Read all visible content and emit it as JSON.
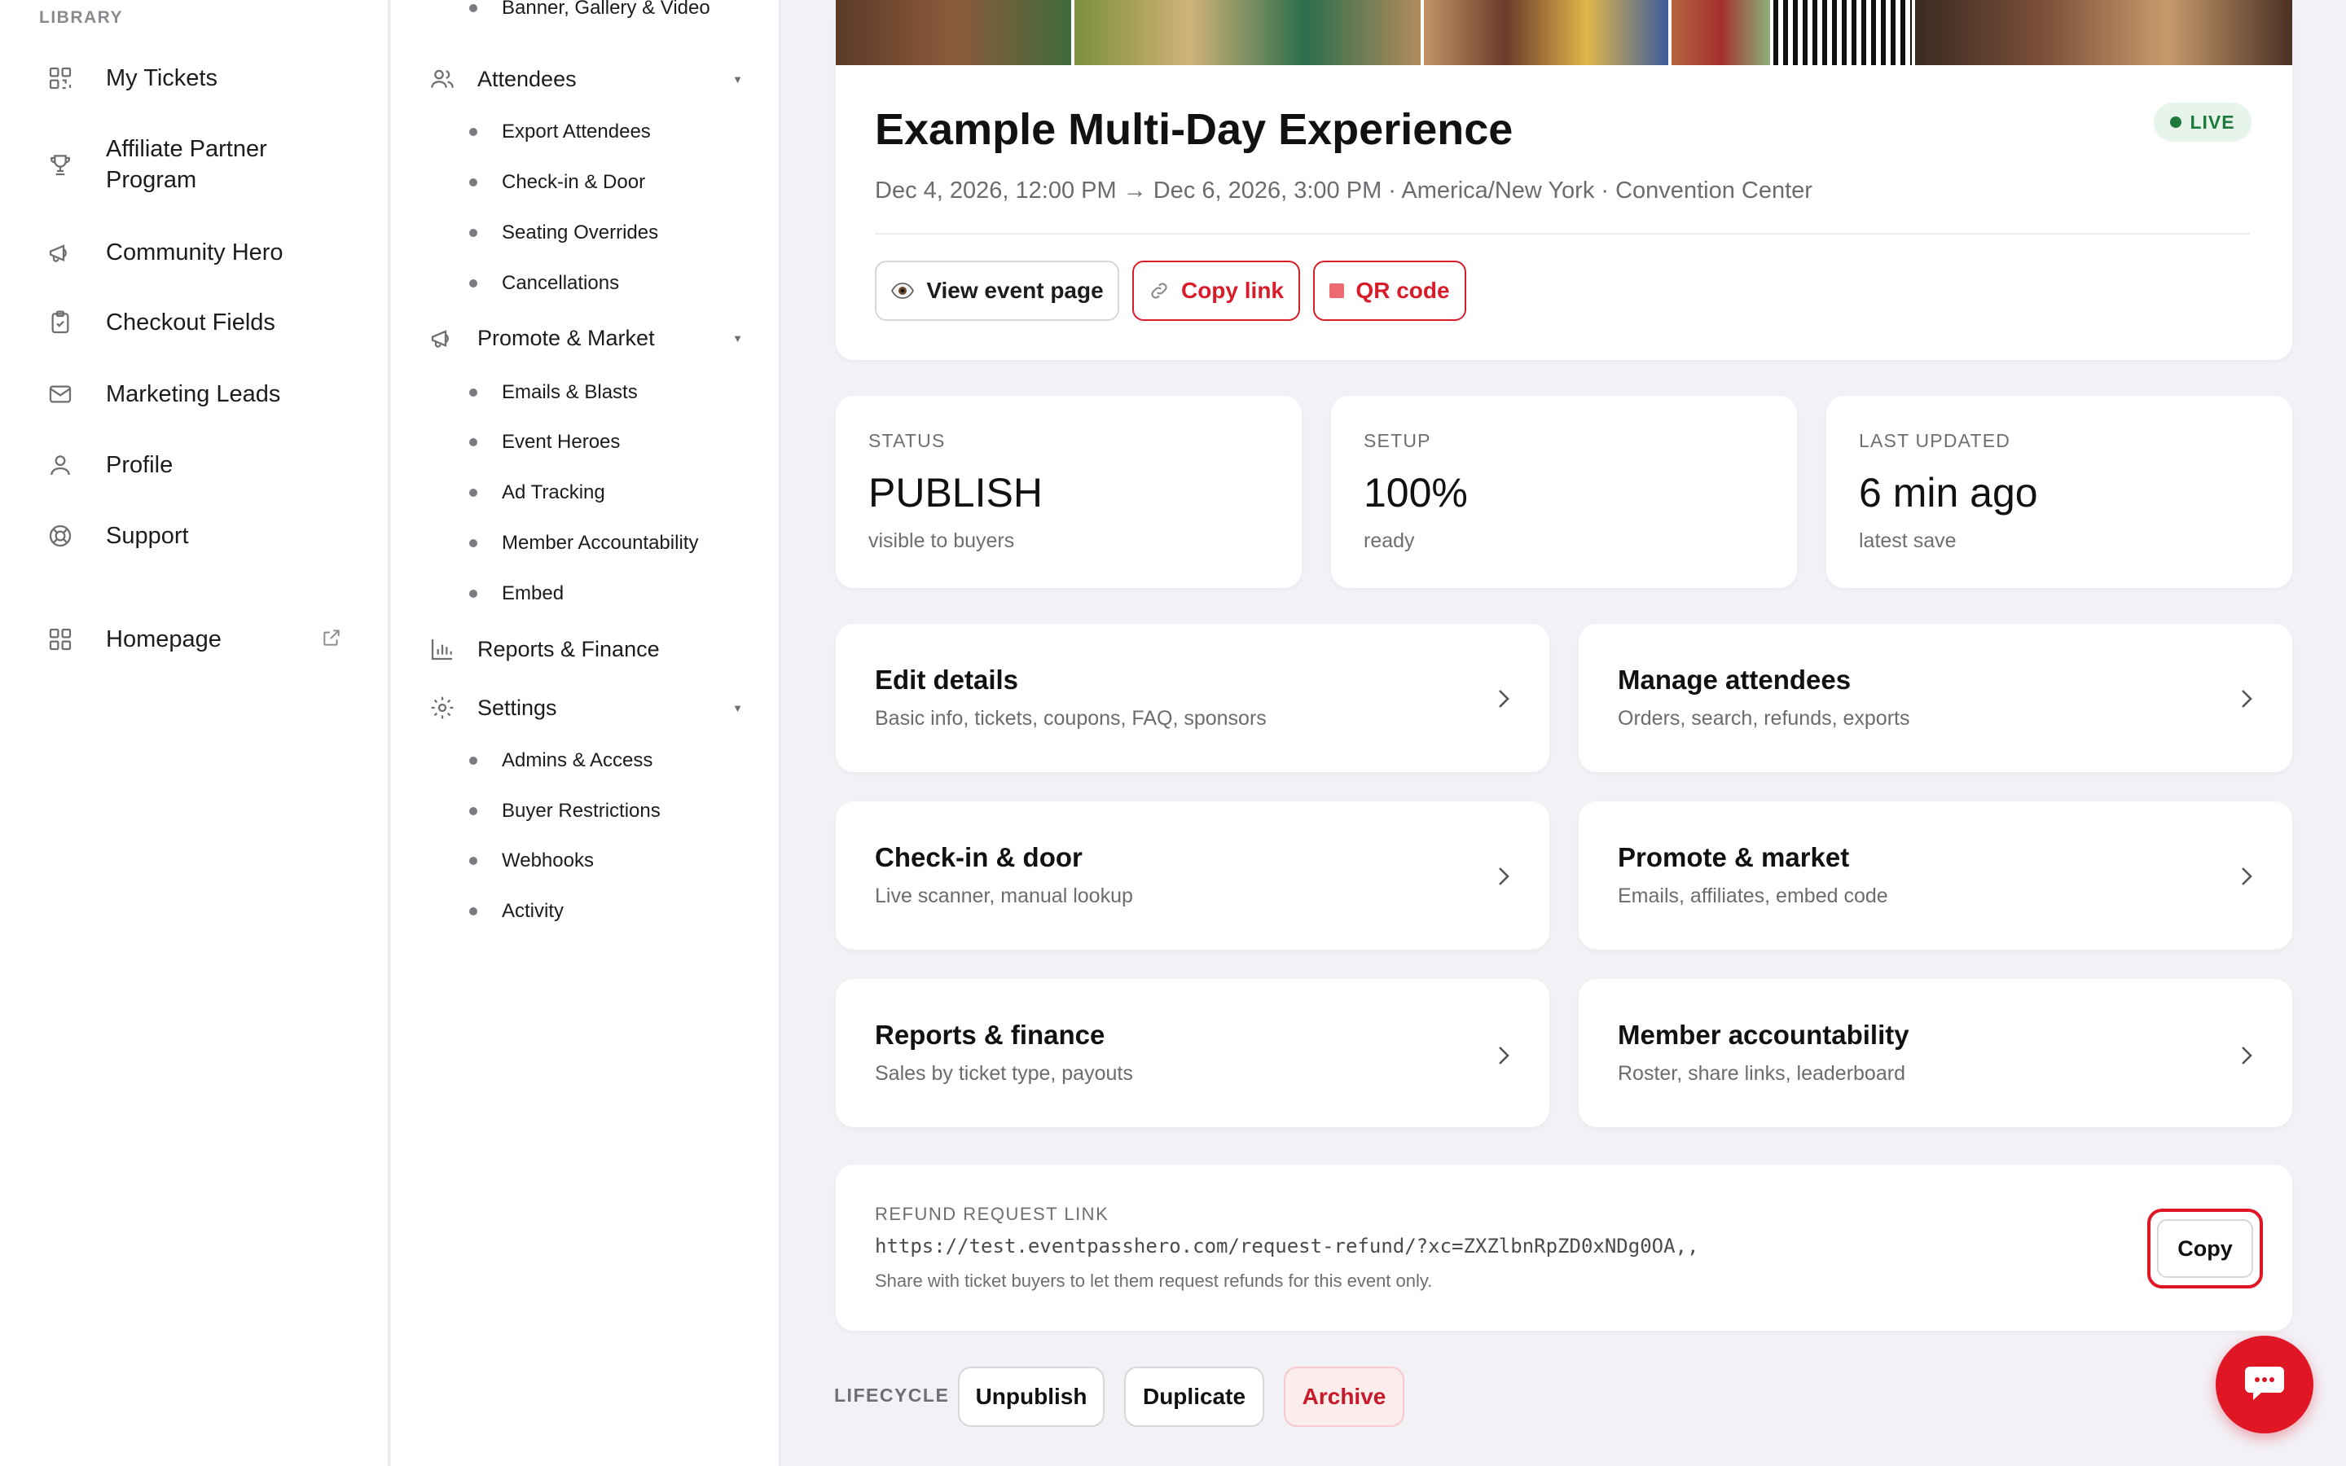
{
  "library_sidebar": {
    "heading": "LIBRARY",
    "items": [
      {
        "label": "My Tickets",
        "icon": "qr-code-icon"
      },
      {
        "label": "Affiliate Partner Program",
        "icon": "trophy-icon"
      },
      {
        "label": "Community Hero",
        "icon": "megaphone-icon"
      },
      {
        "label": "Checkout Fields",
        "icon": "clipboard-check-icon"
      },
      {
        "label": "Marketing Leads",
        "icon": "envelope-icon"
      },
      {
        "label": "Profile",
        "icon": "user-icon"
      },
      {
        "label": "Support",
        "icon": "lifebuoy-icon"
      },
      {
        "label": "Homepage",
        "icon": "grid-icon"
      }
    ]
  },
  "event_nav": {
    "top_partial": "Banner, Gallery & Video",
    "attendees": {
      "label": "Attendees",
      "children": [
        "Export Attendees",
        "Check-in & Door",
        "Seating Overrides",
        "Cancellations"
      ]
    },
    "promote": {
      "label": "Promote & Market",
      "children": [
        "Emails & Blasts",
        "Event Heroes",
        "Ad Tracking",
        "Member Accountability",
        "Embed"
      ]
    },
    "reports": {
      "label": "Reports & Finance"
    },
    "settings": {
      "label": "Settings",
      "children": [
        "Admins & Access",
        "Buyer Restrictions",
        "Webhooks",
        "Activity"
      ]
    }
  },
  "event": {
    "title": "Example Multi-Day Experience",
    "subtitle": "Dec 4, 2026, 12:00 PM → Dec 6, 2026, 3:00 PM · America/New York · Convention Center",
    "status_badge": "LIVE",
    "buttons": {
      "view": "View event page",
      "copy_link": "Copy link",
      "qr": "QR code"
    }
  },
  "stats": [
    {
      "label": "STATUS",
      "value": "PUBLISH",
      "caption": "visible to buyers"
    },
    {
      "label": "SETUP",
      "value": "100%",
      "caption": "ready"
    },
    {
      "label": "LAST UPDATED",
      "value": "6 min ago",
      "caption": "latest save"
    }
  ],
  "actions": [
    {
      "title": "Edit details",
      "desc": "Basic info, tickets, coupons, FAQ, sponsors"
    },
    {
      "title": "Manage attendees",
      "desc": "Orders, search, refunds, exports"
    },
    {
      "title": "Check-in & door",
      "desc": "Live scanner, manual lookup"
    },
    {
      "title": "Promote & market",
      "desc": "Emails, affiliates, embed code"
    },
    {
      "title": "Reports & finance",
      "desc": "Sales by ticket type, payouts"
    },
    {
      "title": "Member accountability",
      "desc": "Roster, share links, leaderboard"
    }
  ],
  "refund": {
    "label": "REFUND REQUEST LINK",
    "url": "https://test.eventpasshero.com/request-refund/?xc=ZXZlbnRpZD0xNDg0OA,,",
    "help": "Share with ticket buyers to let them request refunds for this event only.",
    "copy_label": "Copy"
  },
  "lifecycle": {
    "label": "LIFECYCLE",
    "unpublish": "Unpublish",
    "duplicate": "Duplicate",
    "archive": "Archive"
  },
  "colors": {
    "accent_red": "#d91c2a",
    "live_green": "#1e7a3a",
    "background": "#f2f1f6"
  }
}
